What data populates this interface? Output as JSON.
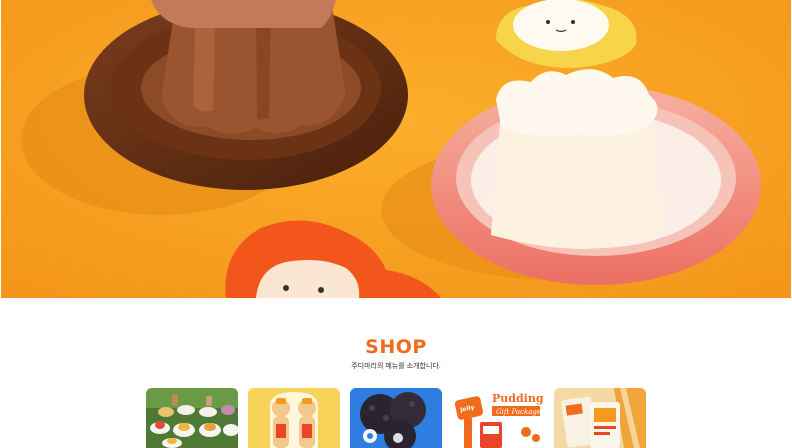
{
  "hero": {
    "icon": "ceramic-pudding-dishes-photo",
    "background": "#f7a021"
  },
  "shop": {
    "title": "SHOP",
    "subtitle": "주디마리의 메뉴를 소개합니다."
  },
  "products": [
    {
      "icon": "pudding-platter-photo"
    },
    {
      "icon": "honey-bear-bottles-photo"
    },
    {
      "icon": "chocolate-cookies-photo"
    },
    {
      "icon": "pudding-gift-package-photo",
      "lettering": [
        "Jolly Pudding",
        "Pudding",
        "Gift Package"
      ]
    },
    {
      "icon": "pudding-mix-bags-photo"
    }
  ],
  "colors": {
    "accent": "#f26b1d",
    "hero_orange": "#f7a021"
  }
}
